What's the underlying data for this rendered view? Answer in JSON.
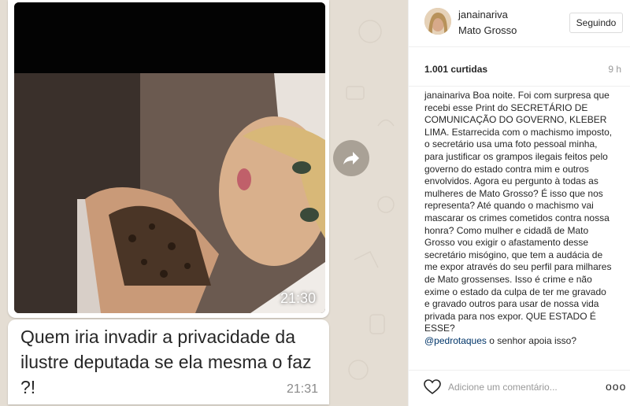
{
  "chat": {
    "photo_time": "21:30",
    "message": "Quem iria invadir a privacidade da ilustre deputada se ela mesma o faz ?!",
    "message_time": "21:31"
  },
  "post": {
    "username": "janainariva",
    "location": "Mato Grosso",
    "follow_button": "Seguindo",
    "likes": "1.001 curtidas",
    "time_ago": "9 h",
    "caption_user": "janainariva",
    "caption_text": "Boa noite. Foi com surpresa que recebi esse Print do SECRETÁRIO DE COMUNICAÇÃO DO GOVERNO, KLEBER LIMA. Estarrecida com o machismo imposto, o secretário usa uma foto pessoal minha, para justificar os grampos ilegais feitos pelo governo do estado contra mim e outros envolvidos. Agora eu pergunto à todas as mulheres de Mato Grosso? É isso que nos representa? Até quando o machismo vai mascarar os crimes cometidos contra nossa honra? Como mulher e cidadã de Mato Grosso vou exigir o afastamento desse secretário misógino, que tem a audácia de me expor através do seu perfil para milhares de Mato grossenses. Isso é crime e não exime o estado da culpa de ter me gravado e gravado outros para usar de nossa vida privada para nos expor. QUE ESTADO É ESSE?",
    "mention": "@pedrotaques",
    "mention_text": "o senhor apoia isso?",
    "comment_placeholder": "Adicione um comentário...",
    "more_label": "ooo"
  },
  "icons": {
    "forward": "forward-arrow-icon",
    "heart": "heart-outline-icon",
    "more": "more-options-icon"
  }
}
